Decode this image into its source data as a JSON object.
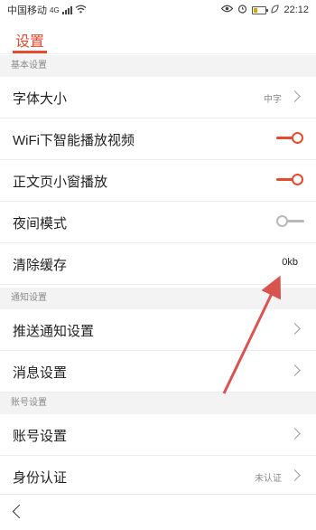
{
  "status_bar": {
    "carrier": "中国移动",
    "network": "4G",
    "time": "22:12",
    "icons": [
      "signal-icon",
      "wifi-icon",
      "eye-icon",
      "alarm-icon",
      "battery-icon",
      "leaf-icon"
    ]
  },
  "header": {
    "title": "设置"
  },
  "sections": {
    "basic": "基本设置",
    "notify": "通知设置",
    "account": "账号设置"
  },
  "rows": {
    "font_size": {
      "label": "字体大小",
      "value": "中字"
    },
    "wifi_video": {
      "label": "WiFi下智能播放视频",
      "toggle": "on"
    },
    "small_window": {
      "label": "正文页小窗播放",
      "toggle": "on"
    },
    "night_mode": {
      "label": "夜间模式",
      "toggle": "off"
    },
    "clear_cache": {
      "label": "清除缓存",
      "value": "0kb"
    },
    "push_notify": {
      "label": "推送通知设置"
    },
    "message": {
      "label": "消息设置"
    },
    "account": {
      "label": "账号设置"
    },
    "identity": {
      "label": "身份认证",
      "value": "未认证"
    }
  },
  "colors": {
    "accent": "#e84a2e",
    "section_bg": "#f3f3f3",
    "annotation_arrow": "#d9534f"
  }
}
